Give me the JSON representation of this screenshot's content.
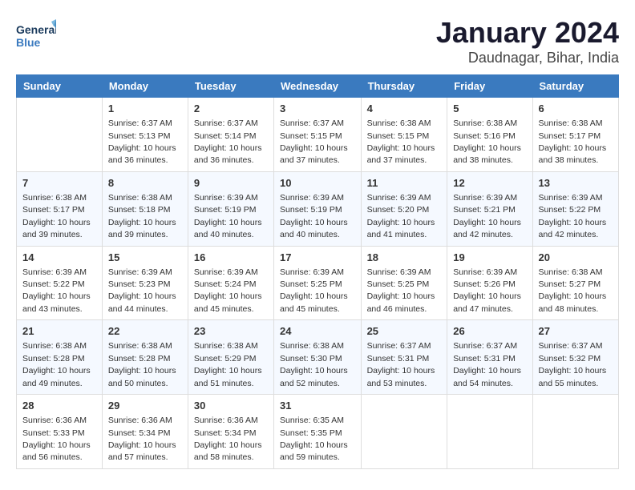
{
  "header": {
    "logo_line1": "General",
    "logo_line2": "Blue",
    "month": "January 2024",
    "location": "Daudnagar, Bihar, India"
  },
  "weekdays": [
    "Sunday",
    "Monday",
    "Tuesday",
    "Wednesday",
    "Thursday",
    "Friday",
    "Saturday"
  ],
  "weeks": [
    [
      null,
      {
        "day": 1,
        "sunrise": "6:37 AM",
        "sunset": "5:13 PM",
        "daylight": "10 hours and 36 minutes."
      },
      {
        "day": 2,
        "sunrise": "6:37 AM",
        "sunset": "5:14 PM",
        "daylight": "10 hours and 36 minutes."
      },
      {
        "day": 3,
        "sunrise": "6:37 AM",
        "sunset": "5:15 PM",
        "daylight": "10 hours and 37 minutes."
      },
      {
        "day": 4,
        "sunrise": "6:38 AM",
        "sunset": "5:15 PM",
        "daylight": "10 hours and 37 minutes."
      },
      {
        "day": 5,
        "sunrise": "6:38 AM",
        "sunset": "5:16 PM",
        "daylight": "10 hours and 38 minutes."
      },
      {
        "day": 6,
        "sunrise": "6:38 AM",
        "sunset": "5:17 PM",
        "daylight": "10 hours and 38 minutes."
      }
    ],
    [
      {
        "day": 7,
        "sunrise": "6:38 AM",
        "sunset": "5:17 PM",
        "daylight": "10 hours and 39 minutes."
      },
      {
        "day": 8,
        "sunrise": "6:38 AM",
        "sunset": "5:18 PM",
        "daylight": "10 hours and 39 minutes."
      },
      {
        "day": 9,
        "sunrise": "6:39 AM",
        "sunset": "5:19 PM",
        "daylight": "10 hours and 40 minutes."
      },
      {
        "day": 10,
        "sunrise": "6:39 AM",
        "sunset": "5:19 PM",
        "daylight": "10 hours and 40 minutes."
      },
      {
        "day": 11,
        "sunrise": "6:39 AM",
        "sunset": "5:20 PM",
        "daylight": "10 hours and 41 minutes."
      },
      {
        "day": 12,
        "sunrise": "6:39 AM",
        "sunset": "5:21 PM",
        "daylight": "10 hours and 42 minutes."
      },
      {
        "day": 13,
        "sunrise": "6:39 AM",
        "sunset": "5:22 PM",
        "daylight": "10 hours and 42 minutes."
      }
    ],
    [
      {
        "day": 14,
        "sunrise": "6:39 AM",
        "sunset": "5:22 PM",
        "daylight": "10 hours and 43 minutes."
      },
      {
        "day": 15,
        "sunrise": "6:39 AM",
        "sunset": "5:23 PM",
        "daylight": "10 hours and 44 minutes."
      },
      {
        "day": 16,
        "sunrise": "6:39 AM",
        "sunset": "5:24 PM",
        "daylight": "10 hours and 45 minutes."
      },
      {
        "day": 17,
        "sunrise": "6:39 AM",
        "sunset": "5:25 PM",
        "daylight": "10 hours and 45 minutes."
      },
      {
        "day": 18,
        "sunrise": "6:39 AM",
        "sunset": "5:25 PM",
        "daylight": "10 hours and 46 minutes."
      },
      {
        "day": 19,
        "sunrise": "6:39 AM",
        "sunset": "5:26 PM",
        "daylight": "10 hours and 47 minutes."
      },
      {
        "day": 20,
        "sunrise": "6:38 AM",
        "sunset": "5:27 PM",
        "daylight": "10 hours and 48 minutes."
      }
    ],
    [
      {
        "day": 21,
        "sunrise": "6:38 AM",
        "sunset": "5:28 PM",
        "daylight": "10 hours and 49 minutes."
      },
      {
        "day": 22,
        "sunrise": "6:38 AM",
        "sunset": "5:28 PM",
        "daylight": "10 hours and 50 minutes."
      },
      {
        "day": 23,
        "sunrise": "6:38 AM",
        "sunset": "5:29 PM",
        "daylight": "10 hours and 51 minutes."
      },
      {
        "day": 24,
        "sunrise": "6:38 AM",
        "sunset": "5:30 PM",
        "daylight": "10 hours and 52 minutes."
      },
      {
        "day": 25,
        "sunrise": "6:37 AM",
        "sunset": "5:31 PM",
        "daylight": "10 hours and 53 minutes."
      },
      {
        "day": 26,
        "sunrise": "6:37 AM",
        "sunset": "5:31 PM",
        "daylight": "10 hours and 54 minutes."
      },
      {
        "day": 27,
        "sunrise": "6:37 AM",
        "sunset": "5:32 PM",
        "daylight": "10 hours and 55 minutes."
      }
    ],
    [
      {
        "day": 28,
        "sunrise": "6:36 AM",
        "sunset": "5:33 PM",
        "daylight": "10 hours and 56 minutes."
      },
      {
        "day": 29,
        "sunrise": "6:36 AM",
        "sunset": "5:34 PM",
        "daylight": "10 hours and 57 minutes."
      },
      {
        "day": 30,
        "sunrise": "6:36 AM",
        "sunset": "5:34 PM",
        "daylight": "10 hours and 58 minutes."
      },
      {
        "day": 31,
        "sunrise": "6:35 AM",
        "sunset": "5:35 PM",
        "daylight": "10 hours and 59 minutes."
      },
      null,
      null,
      null
    ]
  ]
}
